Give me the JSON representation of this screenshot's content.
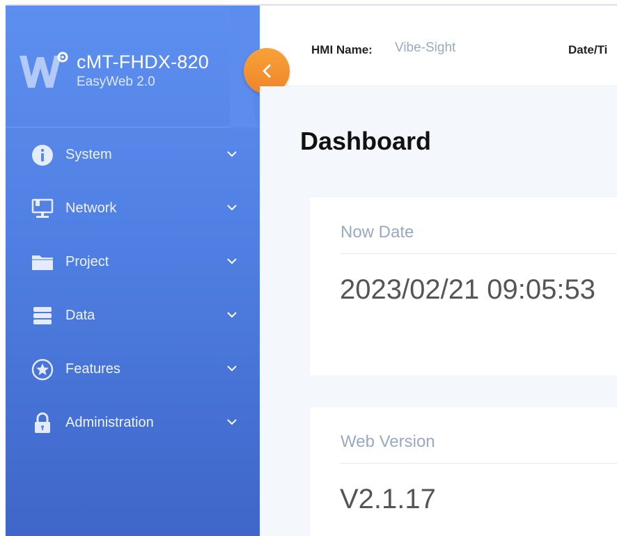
{
  "sidebar": {
    "title": "cMT-FHDX-820",
    "subtitle": "EasyWeb 2.0",
    "items": [
      {
        "label": "System",
        "icon": "info-icon"
      },
      {
        "label": "Network",
        "icon": "network-icon"
      },
      {
        "label": "Project",
        "icon": "folder-icon"
      },
      {
        "label": "Data",
        "icon": "database-icon"
      },
      {
        "label": "Features",
        "icon": "star-icon"
      },
      {
        "label": "Administration",
        "icon": "lock-icon"
      }
    ]
  },
  "header": {
    "hmi_label": "HMI Name:",
    "hmi_value": "Vibe-Sight",
    "date_label": "Date/Ti"
  },
  "main": {
    "title": "Dashboard",
    "cards": [
      {
        "label": "Now Date",
        "value": "2023/02/21 09:05:53"
      },
      {
        "label": "Web Version",
        "value": "V2.1.17"
      }
    ]
  },
  "colors": {
    "sidebar_top": "#5d8ff0",
    "sidebar_bottom": "#3f66c9",
    "accent_orange": "#f29332",
    "content_bg": "#f4f7fb"
  }
}
